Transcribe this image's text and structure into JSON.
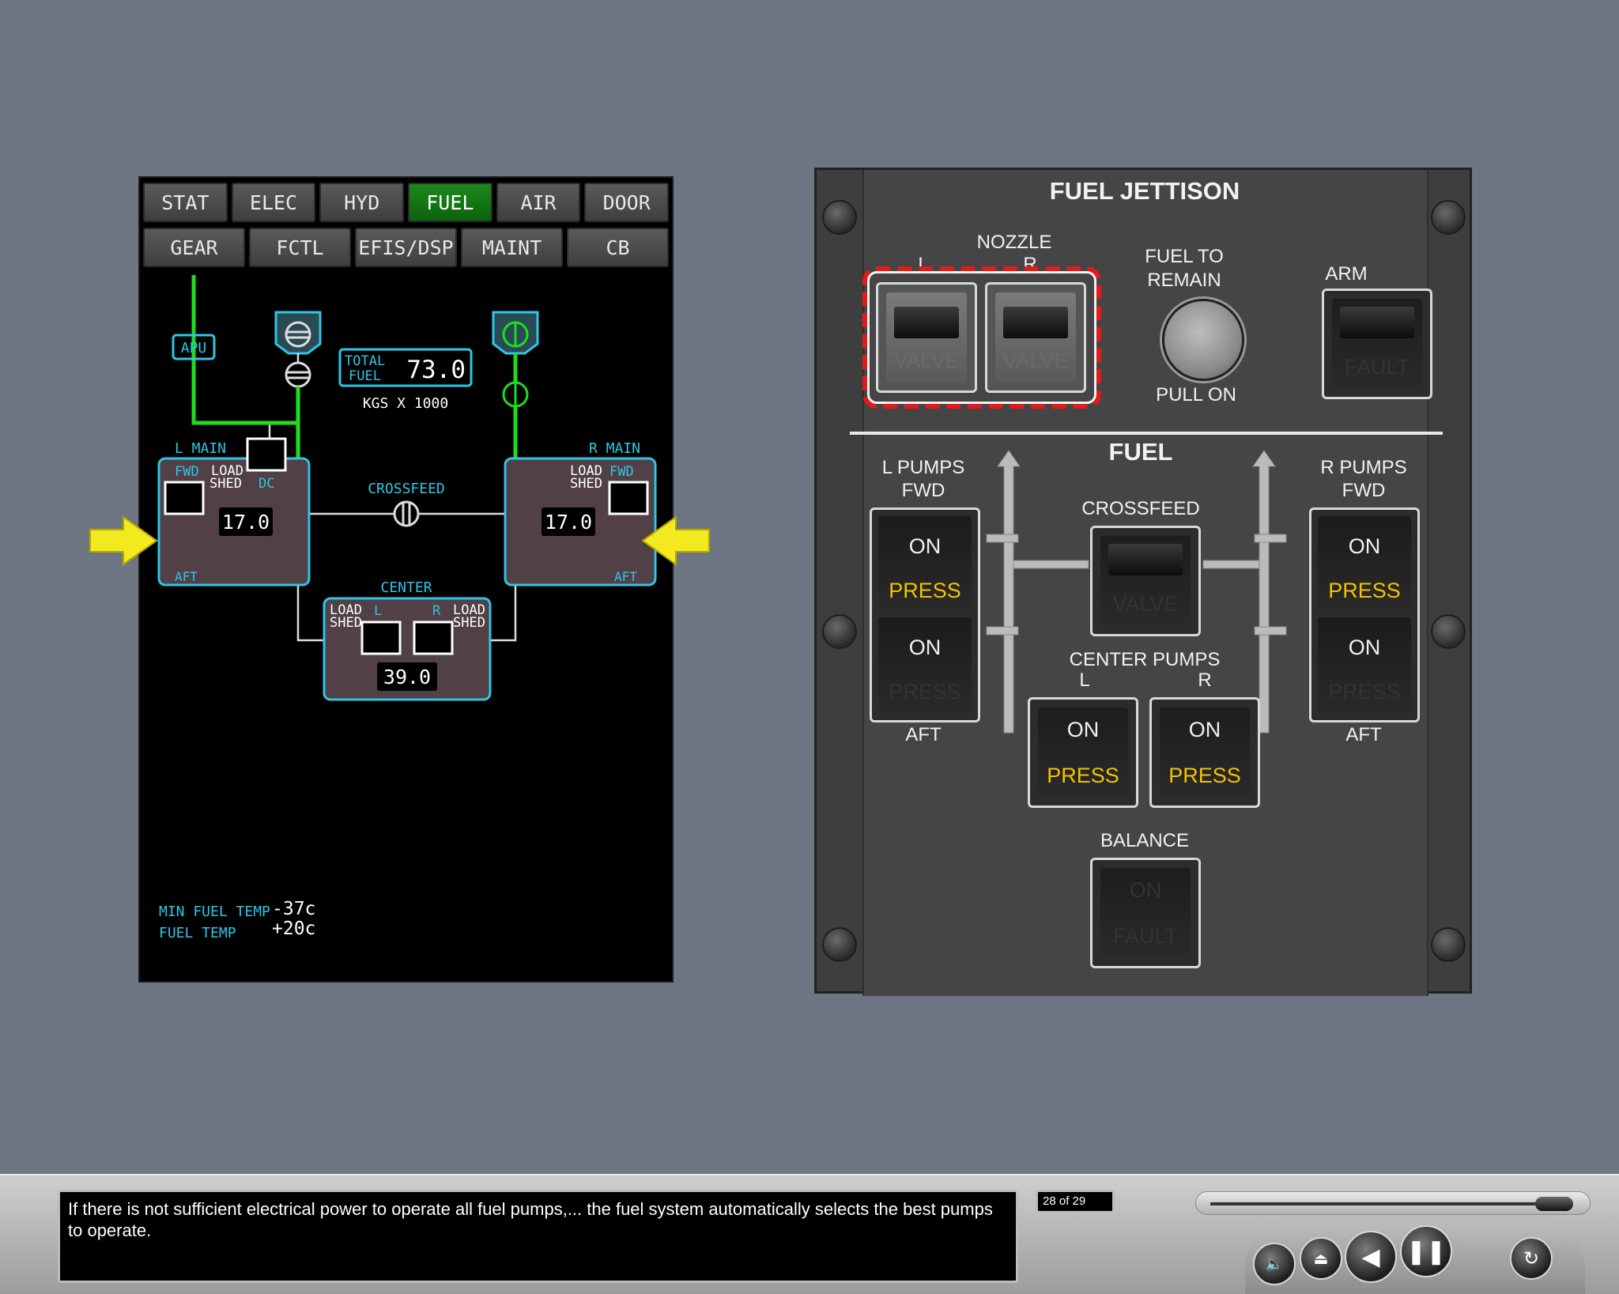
{
  "synoptic": {
    "tabs_row1": [
      "STAT",
      "ELEC",
      "HYD",
      "FUEL",
      "AIR",
      "DOOR"
    ],
    "tabs_row2": [
      "GEAR",
      "FCTL",
      "EFIS/DSP",
      "MAINT",
      "CB"
    ],
    "active_tab": "FUEL",
    "apu": "APU",
    "total_fuel_label_1": "TOTAL",
    "total_fuel_label_2": "FUEL",
    "total_fuel": "73.0",
    "units": "KGS X 1000",
    "crossfeed": "CROSSFEED",
    "l_main": "L MAIN",
    "r_main": "R MAIN",
    "fwd": "FWD",
    "aft": "AFT",
    "load": "LOAD",
    "shed": "SHED",
    "dc": "DC",
    "l_main_qty": "17.0",
    "r_main_qty": "17.0",
    "center": "CENTER",
    "center_l": "L",
    "center_r": "R",
    "center_qty": "39.0",
    "min_fuel_temp_label": "MIN FUEL TEMP",
    "min_fuel_temp": "-37c",
    "fuel_temp_label": "FUEL TEMP",
    "fuel_temp": "+20c"
  },
  "panel": {
    "title": "FUEL JETTISON",
    "nozzle": "NOZZLE",
    "nozzle_l": "L",
    "nozzle_r": "R",
    "valve": "VALVE",
    "fuel_to_remain_1": "FUEL TO",
    "fuel_to_remain_2": "REMAIN",
    "pull_on": "PULL ON",
    "arm": "ARM",
    "fault": "FAULT",
    "fuel": "FUEL",
    "l_pumps_1": "L PUMPS",
    "l_pumps_2": "FWD",
    "r_pumps_1": "R PUMPS",
    "r_pumps_2": "FWD",
    "aft": "AFT",
    "on": "ON",
    "press": "PRESS",
    "crossfeed": "CROSSFEED",
    "center_pumps": "CENTER PUMPS",
    "center_l": "L",
    "center_r": "R",
    "balance": "BALANCE"
  },
  "player": {
    "caption": "If there is not sufficient electrical power to operate all fuel pumps,... the fuel system automatically selects the best pumps to operate.",
    "page_counter": "28 of 29",
    "progress": 0.97,
    "controls": [
      "volume-icon",
      "eject-icon",
      "back-icon",
      "pause-icon",
      "replay-icon"
    ]
  },
  "colors": {
    "background": "#6e7683",
    "synoptic_green": "#1fdc1f",
    "synoptic_cyan": "#2fc6e6",
    "press_amber": "#f3c200"
  }
}
